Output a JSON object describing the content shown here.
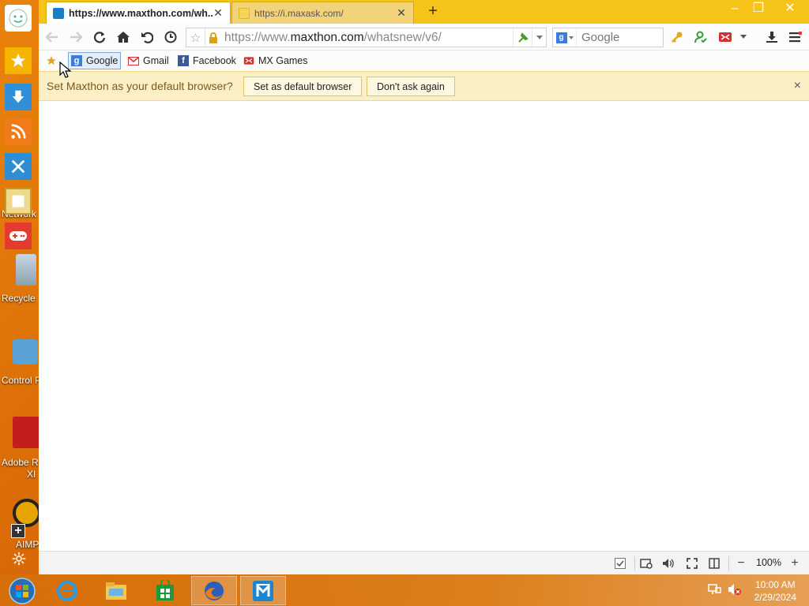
{
  "desktop": {
    "icons": [
      {
        "label": "Network"
      },
      {
        "label": "Recycle"
      },
      {
        "label": "Control P"
      },
      {
        "label": "Adobe R"
      },
      {
        "label": "XI"
      },
      {
        "label": "AIMP"
      }
    ]
  },
  "tabs": [
    {
      "title": "https://www.maxthon.com/wh...",
      "active": true
    },
    {
      "title": "https://i.maxask.com/",
      "active": false
    }
  ],
  "new_tab_label": "+",
  "address": {
    "prefix": "https://www.",
    "domain": "maxthon.com",
    "path": "/whatsnew/v6/"
  },
  "search": {
    "placeholder": "Google"
  },
  "favorites": [
    {
      "label": "Google"
    },
    {
      "label": "Gmail"
    },
    {
      "label": "Facebook"
    },
    {
      "label": "MX Games"
    }
  ],
  "notice": {
    "text": "Set Maxthon as your default browser?",
    "primary": "Set as default browser",
    "secondary": "Don't ask again",
    "close": "×"
  },
  "status": {
    "zoom": "100%",
    "zoom_out": "−",
    "zoom_in": "+"
  },
  "clock": {
    "time": "10:00 AM",
    "date": "2/29/2024"
  },
  "colors": {
    "accent": "#f6c319",
    "notice_bg": "#fbefc5",
    "desktop": "#d96a06"
  }
}
